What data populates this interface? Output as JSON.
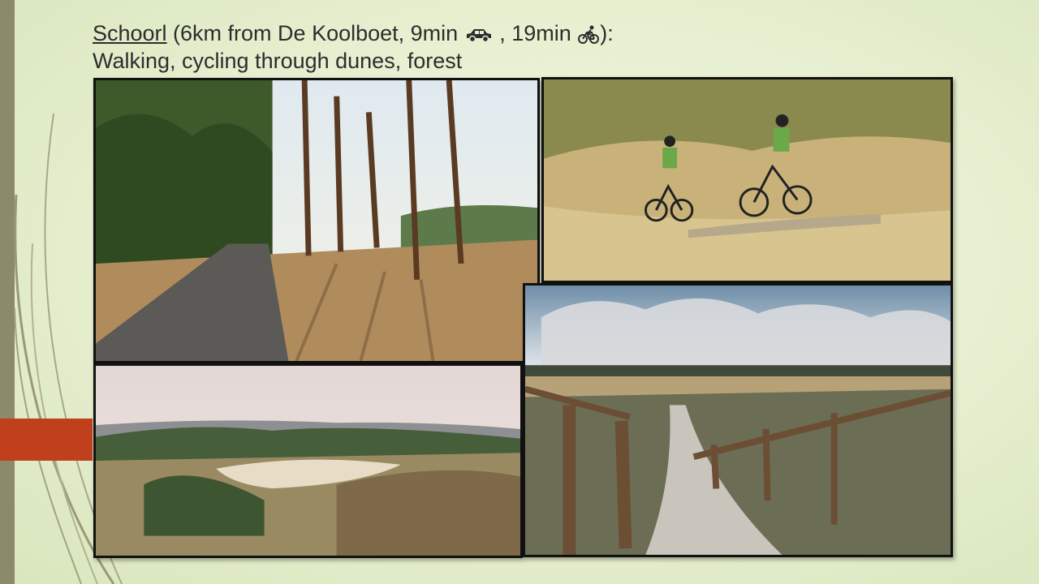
{
  "slide": {
    "title_place": "Schoorl",
    "title_rest_1": " (6km from De Koolboet, 9min",
    "title_sep": " , 19min",
    "title_end": "):",
    "subtitle": "Walking, cycling through dunes, forest",
    "icons": [
      "car-icon",
      "bicycle-icon"
    ],
    "colors": {
      "accent_red": "#c0401e",
      "side_band": "#8b8a6a",
      "background": "#e6efcf"
    }
  },
  "photos": [
    {
      "subject": "forest-road-photo"
    },
    {
      "subject": "mountain-bikers-photo"
    },
    {
      "subject": "dune-landscape-photo"
    },
    {
      "subject": "dune-path-fence-photo"
    }
  ]
}
